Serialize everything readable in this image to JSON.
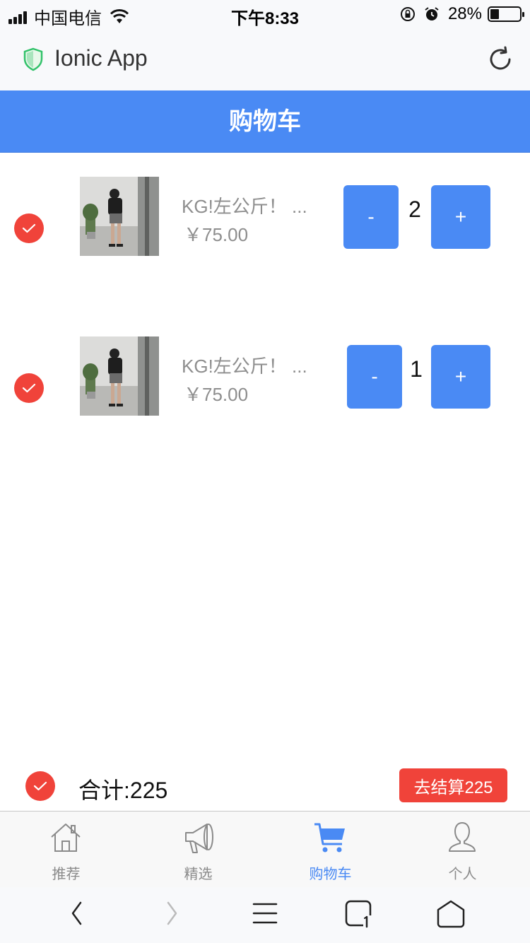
{
  "status_bar": {
    "carrier": "中国电信",
    "time": "下午8:33",
    "battery_percent": "28%",
    "battery_level": 0.28
  },
  "browser": {
    "title": "Ionic App"
  },
  "header": {
    "title": "购物车"
  },
  "cart": {
    "items": [
      {
        "name": "KG!左公斤！ ...",
        "price": "￥75.00",
        "quantity": "2",
        "minus_label": "-",
        "plus_label": "+",
        "checked": true
      },
      {
        "name": "KG!左公斤！ ...",
        "price": "￥75.00",
        "quantity": "1",
        "minus_label": "-",
        "plus_label": "+",
        "checked": true
      }
    ]
  },
  "footer": {
    "total_label": "合计:225",
    "checkout_label": "去结算225"
  },
  "tabs": [
    {
      "label": "推荐",
      "icon": "home-icon",
      "active": false
    },
    {
      "label": "精选",
      "icon": "megaphone-icon",
      "active": false
    },
    {
      "label": "购物车",
      "icon": "cart-icon",
      "active": true
    },
    {
      "label": "个人",
      "icon": "person-icon",
      "active": false
    }
  ],
  "colors": {
    "primary": "#4a8af4",
    "accent_red": "#f0433a",
    "muted_text": "#8e8e8e"
  }
}
